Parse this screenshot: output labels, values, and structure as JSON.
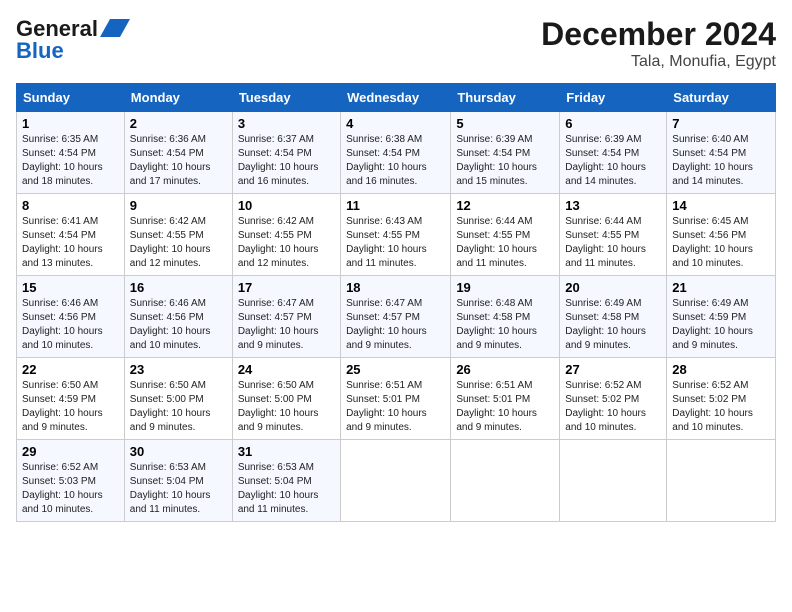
{
  "header": {
    "logo_line1": "General",
    "logo_line2": "Blue",
    "month": "December 2024",
    "location": "Tala, Monufia, Egypt"
  },
  "weekdays": [
    "Sunday",
    "Monday",
    "Tuesday",
    "Wednesday",
    "Thursday",
    "Friday",
    "Saturday"
  ],
  "weeks": [
    [
      {
        "day": "1",
        "sunrise": "Sunrise: 6:35 AM",
        "sunset": "Sunset: 4:54 PM",
        "daylight": "Daylight: 10 hours and 18 minutes."
      },
      {
        "day": "2",
        "sunrise": "Sunrise: 6:36 AM",
        "sunset": "Sunset: 4:54 PM",
        "daylight": "Daylight: 10 hours and 17 minutes."
      },
      {
        "day": "3",
        "sunrise": "Sunrise: 6:37 AM",
        "sunset": "Sunset: 4:54 PM",
        "daylight": "Daylight: 10 hours and 16 minutes."
      },
      {
        "day": "4",
        "sunrise": "Sunrise: 6:38 AM",
        "sunset": "Sunset: 4:54 PM",
        "daylight": "Daylight: 10 hours and 16 minutes."
      },
      {
        "day": "5",
        "sunrise": "Sunrise: 6:39 AM",
        "sunset": "Sunset: 4:54 PM",
        "daylight": "Daylight: 10 hours and 15 minutes."
      },
      {
        "day": "6",
        "sunrise": "Sunrise: 6:39 AM",
        "sunset": "Sunset: 4:54 PM",
        "daylight": "Daylight: 10 hours and 14 minutes."
      },
      {
        "day": "7",
        "sunrise": "Sunrise: 6:40 AM",
        "sunset": "Sunset: 4:54 PM",
        "daylight": "Daylight: 10 hours and 14 minutes."
      }
    ],
    [
      {
        "day": "8",
        "sunrise": "Sunrise: 6:41 AM",
        "sunset": "Sunset: 4:54 PM",
        "daylight": "Daylight: 10 hours and 13 minutes."
      },
      {
        "day": "9",
        "sunrise": "Sunrise: 6:42 AM",
        "sunset": "Sunset: 4:55 PM",
        "daylight": "Daylight: 10 hours and 12 minutes."
      },
      {
        "day": "10",
        "sunrise": "Sunrise: 6:42 AM",
        "sunset": "Sunset: 4:55 PM",
        "daylight": "Daylight: 10 hours and 12 minutes."
      },
      {
        "day": "11",
        "sunrise": "Sunrise: 6:43 AM",
        "sunset": "Sunset: 4:55 PM",
        "daylight": "Daylight: 10 hours and 11 minutes."
      },
      {
        "day": "12",
        "sunrise": "Sunrise: 6:44 AM",
        "sunset": "Sunset: 4:55 PM",
        "daylight": "Daylight: 10 hours and 11 minutes."
      },
      {
        "day": "13",
        "sunrise": "Sunrise: 6:44 AM",
        "sunset": "Sunset: 4:55 PM",
        "daylight": "Daylight: 10 hours and 11 minutes."
      },
      {
        "day": "14",
        "sunrise": "Sunrise: 6:45 AM",
        "sunset": "Sunset: 4:56 PM",
        "daylight": "Daylight: 10 hours and 10 minutes."
      }
    ],
    [
      {
        "day": "15",
        "sunrise": "Sunrise: 6:46 AM",
        "sunset": "Sunset: 4:56 PM",
        "daylight": "Daylight: 10 hours and 10 minutes."
      },
      {
        "day": "16",
        "sunrise": "Sunrise: 6:46 AM",
        "sunset": "Sunset: 4:56 PM",
        "daylight": "Daylight: 10 hours and 10 minutes."
      },
      {
        "day": "17",
        "sunrise": "Sunrise: 6:47 AM",
        "sunset": "Sunset: 4:57 PM",
        "daylight": "Daylight: 10 hours and 9 minutes."
      },
      {
        "day": "18",
        "sunrise": "Sunrise: 6:47 AM",
        "sunset": "Sunset: 4:57 PM",
        "daylight": "Daylight: 10 hours and 9 minutes."
      },
      {
        "day": "19",
        "sunrise": "Sunrise: 6:48 AM",
        "sunset": "Sunset: 4:58 PM",
        "daylight": "Daylight: 10 hours and 9 minutes."
      },
      {
        "day": "20",
        "sunrise": "Sunrise: 6:49 AM",
        "sunset": "Sunset: 4:58 PM",
        "daylight": "Daylight: 10 hours and 9 minutes."
      },
      {
        "day": "21",
        "sunrise": "Sunrise: 6:49 AM",
        "sunset": "Sunset: 4:59 PM",
        "daylight": "Daylight: 10 hours and 9 minutes."
      }
    ],
    [
      {
        "day": "22",
        "sunrise": "Sunrise: 6:50 AM",
        "sunset": "Sunset: 4:59 PM",
        "daylight": "Daylight: 10 hours and 9 minutes."
      },
      {
        "day": "23",
        "sunrise": "Sunrise: 6:50 AM",
        "sunset": "Sunset: 5:00 PM",
        "daylight": "Daylight: 10 hours and 9 minutes."
      },
      {
        "day": "24",
        "sunrise": "Sunrise: 6:50 AM",
        "sunset": "Sunset: 5:00 PM",
        "daylight": "Daylight: 10 hours and 9 minutes."
      },
      {
        "day": "25",
        "sunrise": "Sunrise: 6:51 AM",
        "sunset": "Sunset: 5:01 PM",
        "daylight": "Daylight: 10 hours and 9 minutes."
      },
      {
        "day": "26",
        "sunrise": "Sunrise: 6:51 AM",
        "sunset": "Sunset: 5:01 PM",
        "daylight": "Daylight: 10 hours and 9 minutes."
      },
      {
        "day": "27",
        "sunrise": "Sunrise: 6:52 AM",
        "sunset": "Sunset: 5:02 PM",
        "daylight": "Daylight: 10 hours and 10 minutes."
      },
      {
        "day": "28",
        "sunrise": "Sunrise: 6:52 AM",
        "sunset": "Sunset: 5:02 PM",
        "daylight": "Daylight: 10 hours and 10 minutes."
      }
    ],
    [
      {
        "day": "29",
        "sunrise": "Sunrise: 6:52 AM",
        "sunset": "Sunset: 5:03 PM",
        "daylight": "Daylight: 10 hours and 10 minutes."
      },
      {
        "day": "30",
        "sunrise": "Sunrise: 6:53 AM",
        "sunset": "Sunset: 5:04 PM",
        "daylight": "Daylight: 10 hours and 11 minutes."
      },
      {
        "day": "31",
        "sunrise": "Sunrise: 6:53 AM",
        "sunset": "Sunset: 5:04 PM",
        "daylight": "Daylight: 10 hours and 11 minutes."
      },
      null,
      null,
      null,
      null
    ]
  ]
}
